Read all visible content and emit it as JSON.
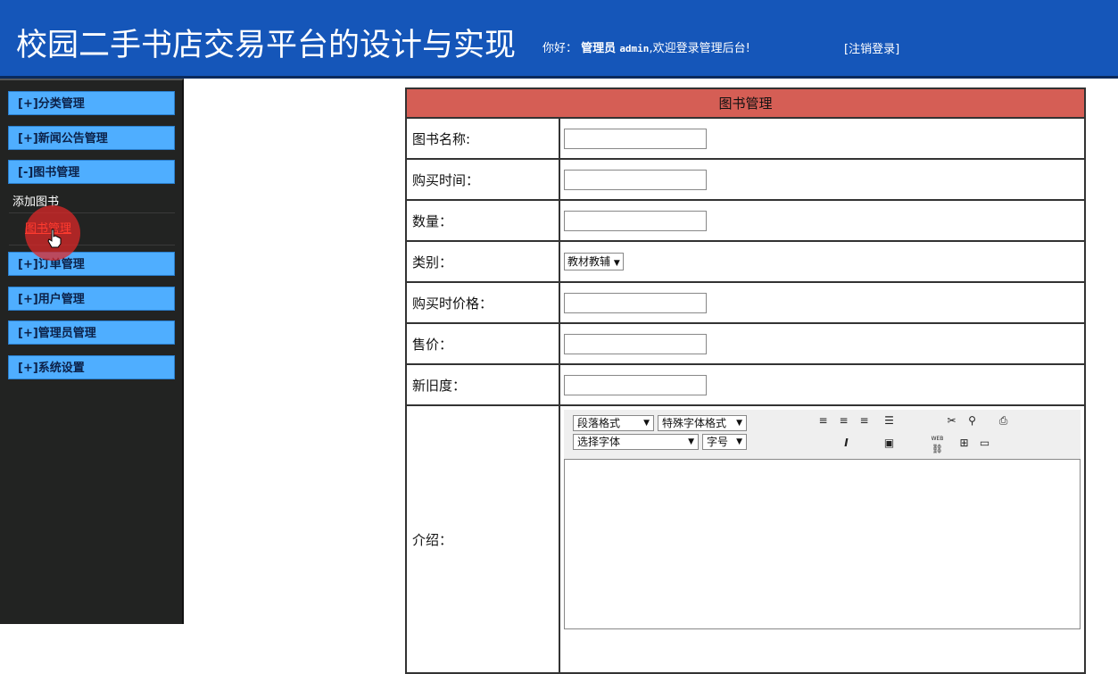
{
  "header": {
    "title": "校园二手书店交易平台的设计与实现",
    "greeting": "你好：",
    "role": "管理员",
    "username": "admin",
    "welcome": ",欢迎登录管理后台!",
    "logout": "[注销登录]"
  },
  "sidebar": {
    "items": [
      {
        "label": "[+]分类管理"
      },
      {
        "label": "[+]新闻公告管理"
      },
      {
        "label": "[-]图书管理"
      },
      {
        "label": "[+]订单管理"
      },
      {
        "label": "[+]用户管理"
      },
      {
        "label": "[+]管理员管理"
      },
      {
        "label": "[+]系统设置"
      }
    ],
    "sub_items": [
      {
        "label": "添加图书"
      },
      {
        "label": "图书管理"
      }
    ]
  },
  "form": {
    "header": "图书管理",
    "fields": [
      {
        "label": "图书名称:",
        "value": ""
      },
      {
        "label": "购买时间：",
        "value": ""
      },
      {
        "label": "数量：",
        "value": ""
      },
      {
        "label": "类别：",
        "select": "教材教辅"
      },
      {
        "label": "购买时价格：",
        "value": ""
      },
      {
        "label": "售价：",
        "value": ""
      },
      {
        "label": "新旧度：",
        "value": ""
      },
      {
        "label": "介绍："
      }
    ],
    "editor": {
      "paragraph": "段落格式",
      "special_font": "特殊字体格式",
      "font": "选择字体",
      "font_size": "字号",
      "web_label": "WEB"
    }
  },
  "colors": {
    "header_bg": "#1556b9",
    "sidebar_bg": "#222322",
    "menu_bg": "#4faeff",
    "table_header_bg": "#d55e55",
    "active_link": "#ff3b2f"
  }
}
